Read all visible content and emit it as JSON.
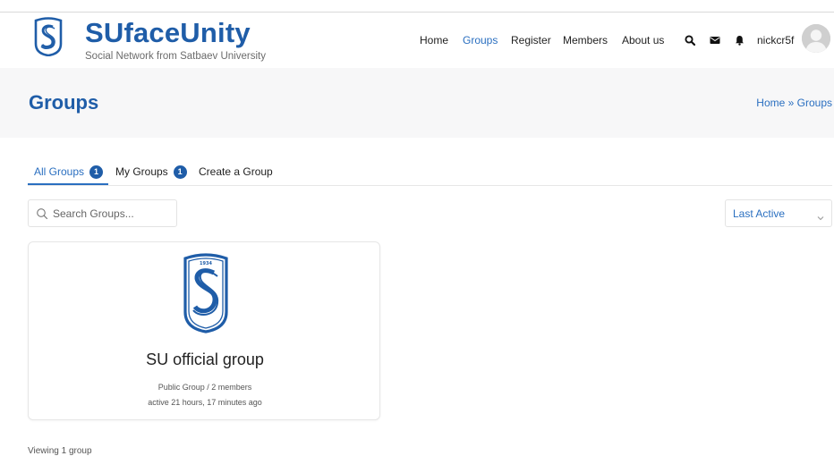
{
  "brand": {
    "title": "SUfaceUnity",
    "subtitle": "Social Network from Satbaev University"
  },
  "nav": {
    "items": [
      {
        "label": "Home"
      },
      {
        "label": "Groups"
      },
      {
        "label": "Register"
      },
      {
        "label": "Members"
      },
      {
        "label": "About us"
      }
    ],
    "active_index": 1,
    "icons": [
      "search-icon",
      "envelope-icon",
      "bell-icon"
    ],
    "username": "nickcr5f"
  },
  "page": {
    "title": "Groups",
    "breadcrumb": "Home » Groups"
  },
  "tabs": [
    {
      "label": "All Groups",
      "count": "1"
    },
    {
      "label": "My Groups",
      "count": "1"
    },
    {
      "label": "Create a Group"
    }
  ],
  "search": {
    "placeholder": "Search Groups...",
    "value": ""
  },
  "sort": {
    "selected": "Last Active"
  },
  "groups": [
    {
      "name": "SU official group",
      "type_members": "Public Group / 2 members",
      "activity": "active 21 hours, 17 minutes ago",
      "logo_year": "1934"
    }
  ],
  "footer": {
    "viewing": "Viewing 1 group"
  },
  "colors": {
    "brand_blue": "#1f5da8",
    "link_blue": "#2a6fc0",
    "title_band": "#f7f7f8"
  }
}
